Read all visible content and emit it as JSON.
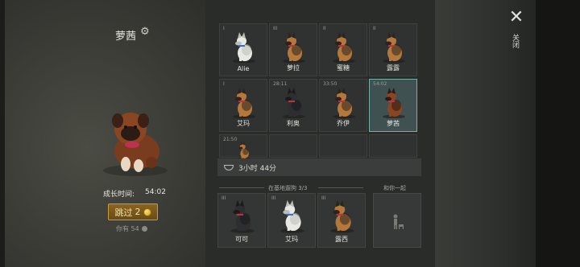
{
  "left_panel": {
    "dog_name": "萝茜",
    "growth_label": "成长时间:",
    "growth_value": "54:02",
    "skip_label": "跳过",
    "skip_cost": "2",
    "have_label": "你有 54"
  },
  "kennel": [
    {
      "tag": "I",
      "name": "Alie",
      "coat": "white"
    },
    {
      "tag": "III",
      "name": "萝拉",
      "coat": "shepherd"
    },
    {
      "tag": "II",
      "name": "蜜糖",
      "coat": "shepherd"
    },
    {
      "tag": "II",
      "name": "露露",
      "coat": "shepherd"
    },
    {
      "tag": "I",
      "name": "艾玛",
      "coat": "shepherd"
    },
    {
      "tag": "28:11",
      "name": "利奥",
      "coat": "black"
    },
    {
      "tag": "33:50",
      "name": "乔伊",
      "coat": "shepherd"
    },
    {
      "tag": "54:02",
      "name": "萝茜",
      "coat": "brown",
      "selected": true
    },
    {
      "tag": "21:50",
      "name": "",
      "coat": "shepherd"
    }
  ],
  "food_timer": "3小时 44分",
  "at_base": {
    "title": "在基地遛狗 3/3",
    "dogs": [
      {
        "tag": "III",
        "name": "可可",
        "coat": "black"
      },
      {
        "tag": "III",
        "name": "艾玛",
        "coat": "white"
      },
      {
        "tag": "III",
        "name": "露西",
        "coat": "shepherd"
      }
    ]
  },
  "together_title": "和你一起",
  "close_label": "关闭",
  "icons": {
    "gear": "gear-icon",
    "close": "close-icon",
    "bowl": "bowl-icon",
    "coin": "coin-icon",
    "person": "person-dog-icon"
  }
}
